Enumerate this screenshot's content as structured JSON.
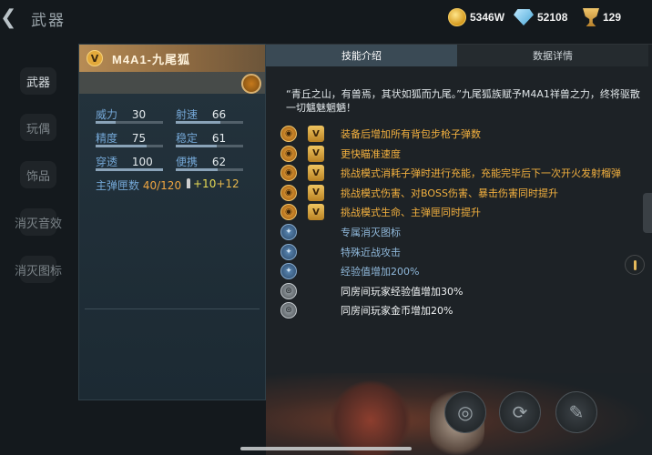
{
  "header": {
    "back_icon": "chevron-left-icon",
    "title": "武器",
    "currencies": [
      {
        "icon": "gold-coin-icon",
        "value": "5346W"
      },
      {
        "icon": "diamond-icon",
        "value": "52108"
      },
      {
        "icon": "trophy-icon",
        "value": "129"
      }
    ]
  },
  "sidebar": {
    "items": [
      {
        "label": "武器",
        "active": true
      },
      {
        "label": "玩偶",
        "active": false
      },
      {
        "label": "饰品",
        "active": false
      },
      {
        "label": "消灭音效",
        "active": false
      },
      {
        "label": "消灭图标",
        "active": false
      }
    ]
  },
  "weapon": {
    "rank": "V",
    "name": "M4A1-九尾狐",
    "stats": [
      {
        "label": "威力",
        "value": "30",
        "fill": 0.3
      },
      {
        "label": "射速",
        "value": "66",
        "fill": 0.66
      },
      {
        "label": "精度",
        "value": "75",
        "fill": 0.75
      },
      {
        "label": "稳定",
        "value": "61",
        "fill": 0.61
      },
      {
        "label": "穿透",
        "value": "100",
        "fill": 1.0
      },
      {
        "label": "便携",
        "value": "62",
        "fill": 0.62
      }
    ],
    "ammo": {
      "label": "主弹匣数",
      "current": "40",
      "max": "120",
      "bonus1": "+10",
      "bonus2": "+12"
    }
  },
  "detail": {
    "tabs": [
      {
        "label": "技能介绍",
        "active": true
      },
      {
        "label": "数据详情",
        "active": false
      }
    ],
    "intro": "“青丘之山，有兽焉，其状如狐而九尾。”九尾狐族赋予M4A1祥兽之力，终将驱散一切魑魅魍魉！",
    "skills": [
      {
        "icon": "gold",
        "ranked": true,
        "text": "装备后增加所有背包步枪子弹数",
        "color": "orange"
      },
      {
        "icon": "gold",
        "ranked": true,
        "text": "更快瞄准速度",
        "color": "orange"
      },
      {
        "icon": "gold",
        "ranked": true,
        "text": "挑战模式消耗子弹时进行充能，充能完毕后下一次开火发射榴弹",
        "color": "orange"
      },
      {
        "icon": "gold",
        "ranked": true,
        "text": "挑战模式伤害、对BOSS伤害、暴击伤害同时提升",
        "color": "orange"
      },
      {
        "icon": "gold",
        "ranked": true,
        "text": "挑战模式生命、主弹匣同时提升",
        "color": "orange"
      },
      {
        "icon": "blue",
        "ranked": false,
        "text": "专属消灭图标",
        "color": "blue"
      },
      {
        "icon": "blue",
        "ranked": false,
        "text": "特殊近战攻击",
        "color": "blue"
      },
      {
        "icon": "blue",
        "ranked": false,
        "text": "经验值增加200%",
        "color": "blue"
      },
      {
        "icon": "gray",
        "ranked": false,
        "text": "同房间玩家经验值增加30%",
        "color": "white"
      },
      {
        "icon": "gray",
        "ranked": false,
        "text": "同房间玩家金币增加20%",
        "color": "white"
      }
    ]
  }
}
